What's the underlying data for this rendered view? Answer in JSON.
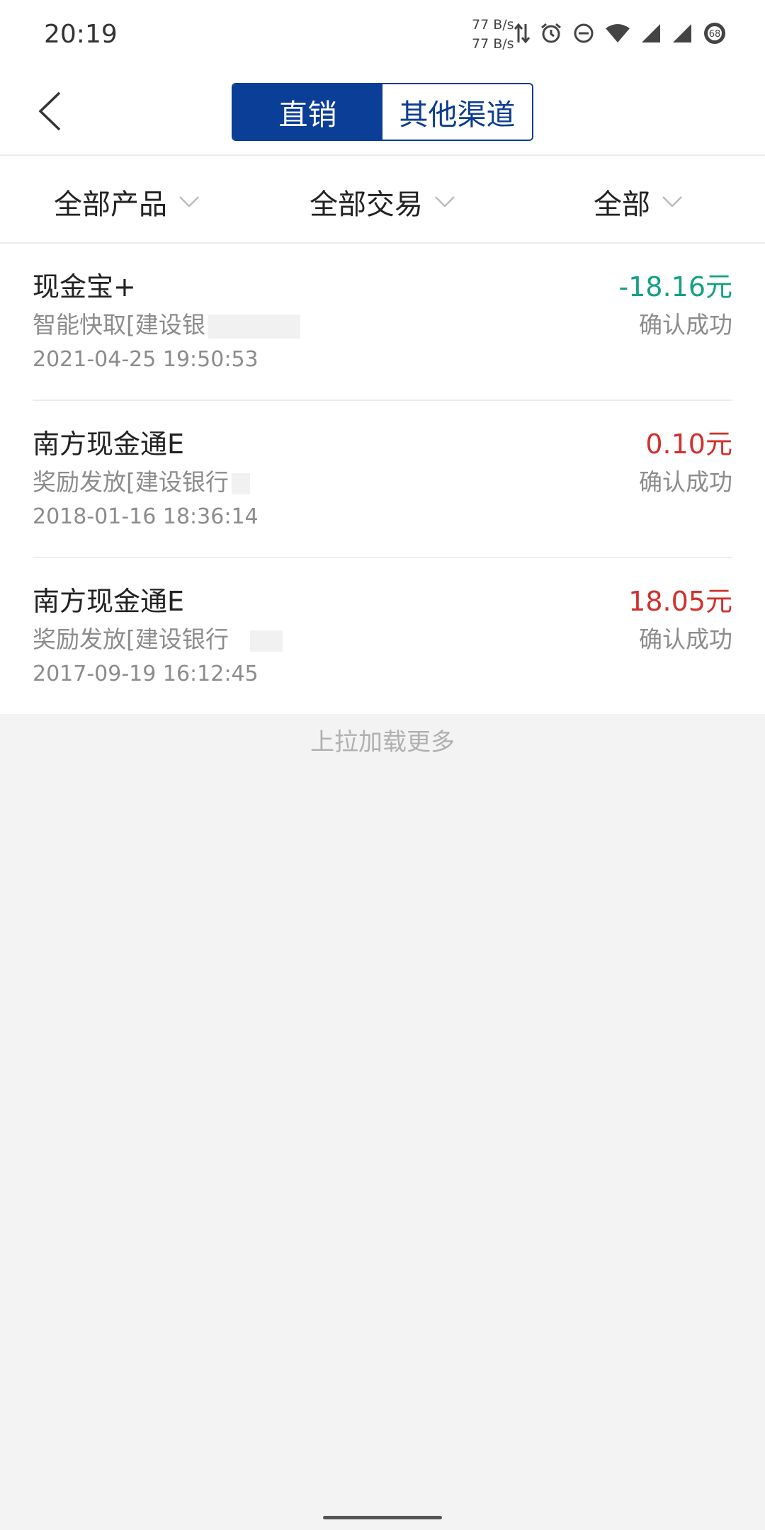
{
  "status_bar": {
    "time": "20:19",
    "net_up": "77 B/s",
    "net_down": "77 B/s",
    "battery": "68",
    "icons": [
      "data-arrows-icon",
      "alarm-icon",
      "dnd-icon",
      "wifi-icon",
      "signal-icon",
      "signal-icon-2",
      "battery-icon"
    ]
  },
  "nav": {
    "back_icon": "chevron-left-icon",
    "tabs": [
      {
        "label": "直销",
        "active": true
      },
      {
        "label": "其他渠道",
        "active": false
      }
    ]
  },
  "filters": [
    {
      "label": "全部产品"
    },
    {
      "label": "全部交易"
    },
    {
      "label": "全部"
    }
  ],
  "transactions": [
    {
      "name": "现金宝+",
      "detail": "智能快取[建设银",
      "date": "2021-04-25 19:50:53",
      "amount": "-18.16元",
      "amount_color": "#16a084",
      "status": "确认成功"
    },
    {
      "name": "南方现金通E",
      "detail": "奖励发放[建设银行",
      "date": "2018-01-16 18:36:14",
      "amount": "0.10元",
      "amount_color": "#d0312d",
      "status": "确认成功"
    },
    {
      "name": "南方现金通E",
      "detail": "奖励发放[建设银行",
      "date": "2017-09-19 16:12:45",
      "amount": "18.05元",
      "amount_color": "#d0312d",
      "status": "确认成功"
    }
  ],
  "load_more": "上拉加载更多",
  "colors": {
    "brand_blue": "#0a3e97",
    "positive_green": "#16a084",
    "income_red": "#d0312d",
    "page_bg": "#f3f3f3"
  }
}
